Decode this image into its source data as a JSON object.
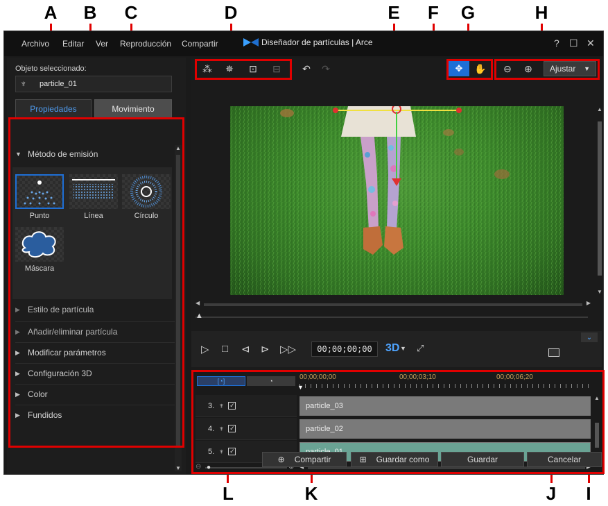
{
  "callouts": [
    "A",
    "B",
    "C",
    "D",
    "E",
    "F",
    "G",
    "H",
    "L",
    "K",
    "J",
    "I"
  ],
  "menu": {
    "items": [
      "Archivo",
      "Editar",
      "Ver",
      "Reproducción",
      "Compartir"
    ],
    "title": "Diseñador de partículas  |  Arce",
    "help": "?",
    "maximize": "☐",
    "close": "✕"
  },
  "left": {
    "selected_label": "Objeto seleccionado:",
    "selected_value": "particle_01",
    "tabs": [
      "Propiedades",
      "Movimiento"
    ],
    "emission_header": "Método de emisión",
    "emitters": [
      "Punto",
      "Línea",
      "Círculo",
      "Máscara"
    ],
    "sections": [
      "Estilo de partícula",
      "Añadir/eliminar partícula",
      "Modificar parámetros",
      "Configuración 3D",
      "Color",
      "Fundidos"
    ]
  },
  "toolbar": {
    "zoom_label": "Ajustar",
    "undo": "↶",
    "redo": "↷"
  },
  "controls": {
    "timecode": "00;00;00;00",
    "mode_3d": "3D"
  },
  "timeline": {
    "ticks": [
      "00;00;00;00",
      "00;00;03;10",
      "00;00;06;20"
    ],
    "tracks": [
      {
        "index": "3.",
        "name": "particle_03"
      },
      {
        "index": "4.",
        "name": "particle_02"
      },
      {
        "index": "5.",
        "name": "particle_01"
      }
    ]
  },
  "bottom": {
    "share": "Compartir",
    "save_as": "Guardar como",
    "save": "Guardar",
    "cancel": "Cancelar"
  },
  "colors": {
    "callout_red": "#e00000",
    "accent_blue": "#1e6fd6",
    "clip_gray": "#7a7a7a",
    "clip_selected": "#6aa394"
  }
}
